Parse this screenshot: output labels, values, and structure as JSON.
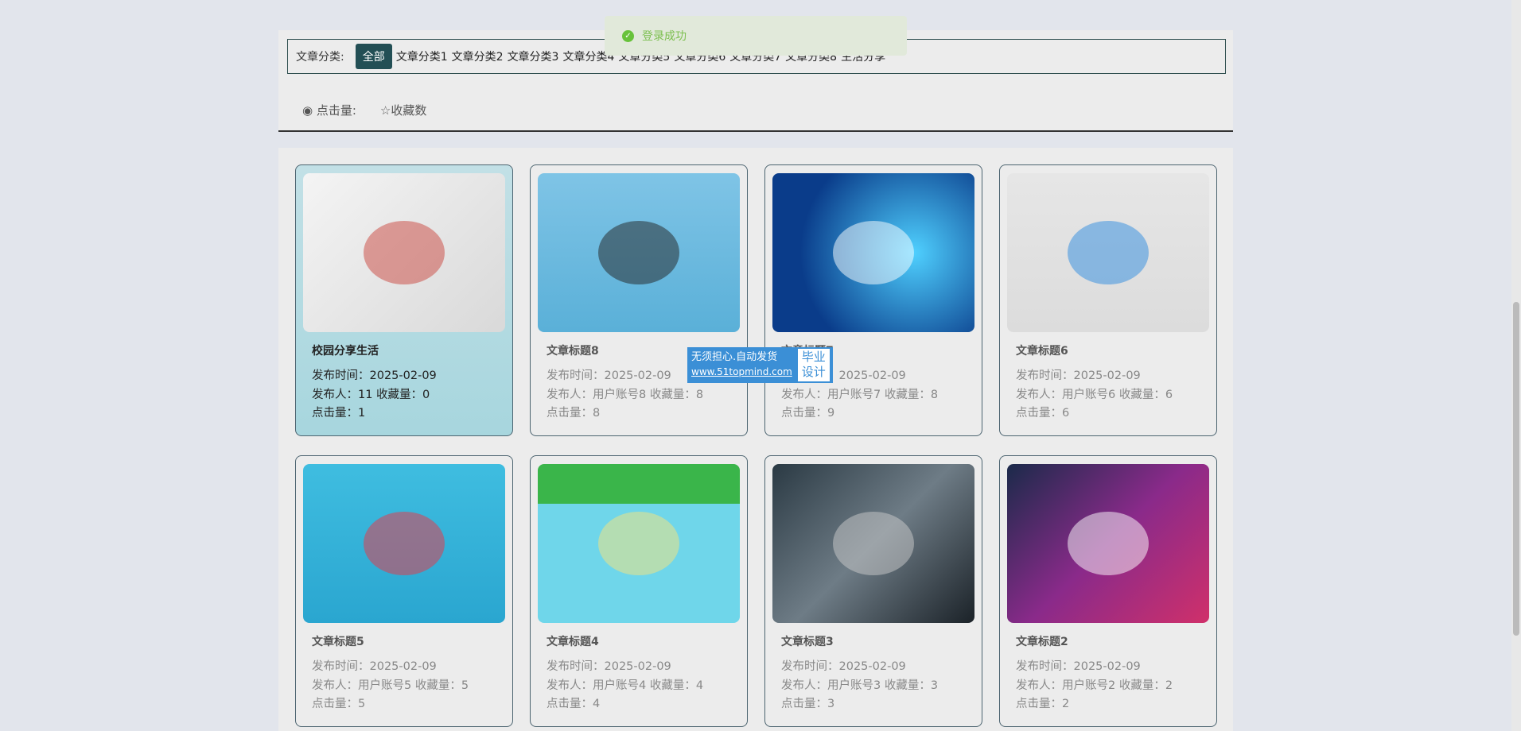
{
  "toast": {
    "message": "登录成功",
    "icon": "check-circle-icon"
  },
  "filter": {
    "label": "文章分类:",
    "categories": [
      "全部",
      "文章分类1",
      "文章分类2",
      "文章分类3",
      "文章分类4",
      "文章分类5",
      "文章分类6",
      "文章分类7",
      "文章分类8",
      "生活分享"
    ],
    "active": 0
  },
  "sorts": {
    "clicks": "点击量:",
    "favorites": "收藏数"
  },
  "ad": {
    "line1": "无须担心.自动发货",
    "url": "www.51topmind.com",
    "badge1": "毕业",
    "badge2": "设计"
  },
  "cards": [
    {
      "title": "校园分享生活",
      "time": "发布时间：2025-02-09",
      "meta": "发布人：11   收藏量：0",
      "clicks": "点击量：1",
      "img": "linear-gradient(135deg,#f4f4f4,#d9d9d9)",
      "accent": "#c9463d"
    },
    {
      "title": "文章标题8",
      "time": "发布时间：2025-02-09",
      "meta": "发布人：用户账号8   收藏量：8",
      "clicks": "点击量：8",
      "img": "linear-gradient(#7fc4e6,#5ab0d8)",
      "accent": "#222"
    },
    {
      "title": "文章标题7",
      "time": "发布时间：2025-02-09",
      "meta": "发布人：用户账号7   收藏量：8",
      "clicks": "点击量：9",
      "img": "radial-gradient(circle at 70% 50%,#4fd0ff,#0a3c8a 70%)",
      "accent": "#fff"
    },
    {
      "title": "文章标题6",
      "time": "发布时间：2025-02-09",
      "meta": "发布人：用户账号6   收藏量：6",
      "clicks": "点击量：6",
      "img": "linear-gradient(#e6e6e6,#dcdcdc)",
      "accent": "#2d8be0"
    },
    {
      "title": "文章标题5",
      "time": "发布时间：2025-02-09",
      "meta": "发布人：用户账号5   收藏量：5",
      "clicks": "点击量：5",
      "img": "linear-gradient(#3fbde0,#2aa6d0)",
      "accent": "#e34"
    },
    {
      "title": "文章标题4",
      "time": "发布时间：2025-02-09",
      "meta": "发布人：用户账号4   收藏量：4",
      "clicks": "点击量：4",
      "img": "linear-gradient(#3ab54a 25%,#6fd6ea 25%)",
      "accent": "#f9e37a"
    },
    {
      "title": "文章标题3",
      "time": "发布时间：2025-02-09",
      "meta": "发布人：用户账号3   收藏量：3",
      "clicks": "点击量：3",
      "img": "linear-gradient(135deg,#2b3a44,#6e7c86,#1b2228)",
      "accent": "#ccc"
    },
    {
      "title": "文章标题2",
      "time": "发布时间：2025-02-09",
      "meta": "发布人：用户账号2   收藏量：2",
      "clicks": "点击量：2",
      "img": "linear-gradient(135deg,#1b2a4a,#8a2a8a,#d0306a)",
      "accent": "#fff"
    }
  ]
}
